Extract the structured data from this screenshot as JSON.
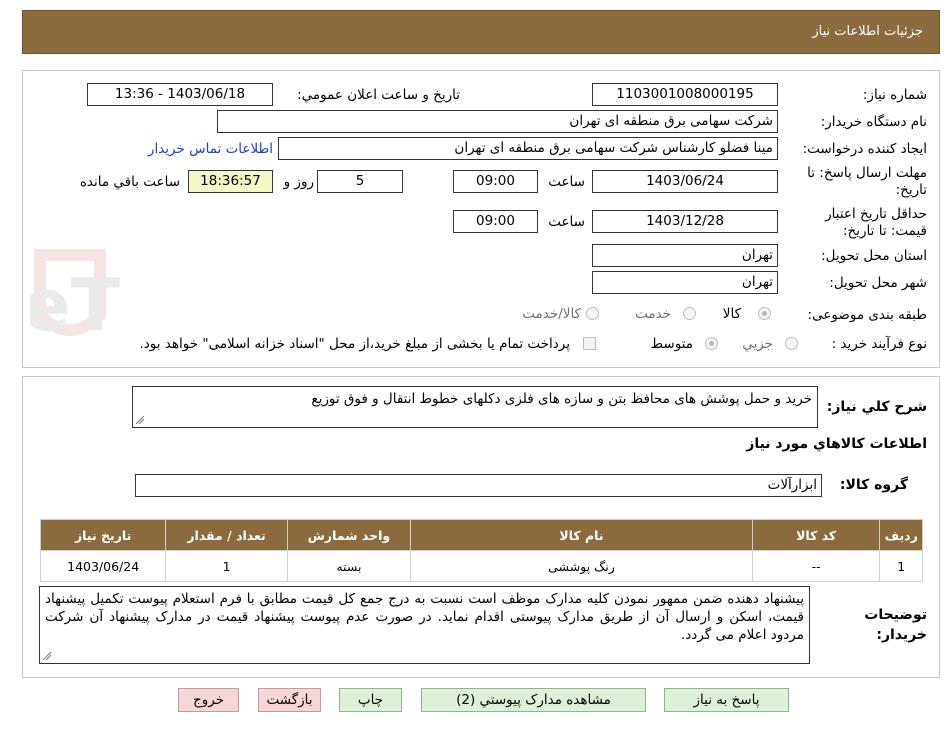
{
  "header": {
    "title": "جزئيات اطلاعات نياز"
  },
  "watermark": {
    "text": "AriaTender.neT"
  },
  "form": {
    "need_number_label": "شماره نياز:",
    "need_number": "1103001008000195",
    "announce_label": "تاريخ و ساعت اعلان عمومي:",
    "announce_value": "1403/06/18 - 13:36",
    "buyer_org_label": "نام دستگاه خريدار:",
    "buyer_org": "شرکت سهامی برق منطقه ای تهران",
    "requester_label": "ايجاد کننده درخواست:",
    "requester": "مینا فضلو کارشناس شرکت سهامی برق منطقه ای تهران",
    "contact_link": "اطلاعات تماس خريدار",
    "deadline_label": "مهلت ارسال پاسخ: تا تاريخ:",
    "deadline_date": "1403/06/24",
    "time_label": "ساعت",
    "deadline_time": "09:00",
    "days_value": "5",
    "days_label": "روز و",
    "remaining_time": "18:36:57",
    "remaining_label": "ساعت باقي مانده",
    "validity_label": "حداقل تاريخ اعتبار قيمت: تا تاريخ:",
    "validity_date": "1403/12/28",
    "validity_time": "09:00",
    "province_label": "استان محل تحويل:",
    "province": "تهران",
    "city_label": "شهر محل تحويل:",
    "city": "تهران",
    "category_label": "طبقه بندی موضوعی:",
    "category_options": [
      "کالا",
      "خدمت",
      "کالا/خدمت"
    ],
    "category_selected": "کالا",
    "process_label": "نوع فرآيند خريد :",
    "process_options": [
      "جزيي",
      "متوسط"
    ],
    "process_selected": "متوسط",
    "payment_note": "پرداخت تمام يا بخشی از مبلغ خريد،از محل \"اسناد خزانه اسلامی\" خواهد بود."
  },
  "summary": {
    "desc_label": "شرح کلي نياز:",
    "desc": "خرید و حمل پوشش های محافظ بتن و سازه های فلزی دکلهای خطوط انتقال و فوق توزیع",
    "items_title": "اطلاعات کالاهاي مورد نياز",
    "group_label": "گروه کالا:",
    "group": "ابزارآلات"
  },
  "table": {
    "headers": [
      "رديف",
      "کد کالا",
      "نام کالا",
      "واحد شمارش",
      "تعداد / مقدار",
      "تاريخ نياز"
    ],
    "rows": [
      [
        "1",
        "--",
        "رنگ پوششی",
        "بسته",
        "1",
        "1403/06/24"
      ]
    ]
  },
  "buyer_notes": {
    "label": "توضيحات خريدار:",
    "text": "پیشنهاد دهنده ضمن ممهور نمودن کلیه مدارک موظف است نسبت به درج جمع کل قیمت مطابق با فرم استعلام پیوست تکمیل پیشنهاد قیمت، اسکن و ارسال آن از طریق مدارک پیوستی اقدام نماید. در صورت عدم پیوست پیشنهاد قیمت در مدارک پیشنهاد آن شرکت مردود اعلام می گردد."
  },
  "buttons": {
    "reply": "پاسخ به نياز",
    "attachments": "مشاهده مدارک پيوستي (2)",
    "print": "چاپ",
    "back": "بازگشت",
    "exit": "خروج"
  }
}
